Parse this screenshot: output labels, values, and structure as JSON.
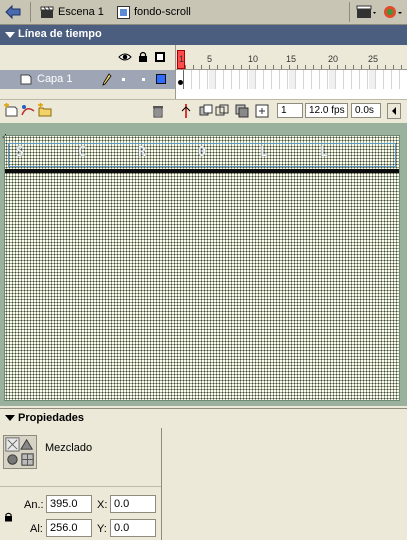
{
  "scene_bar": {
    "scene_label": "Escena 1",
    "symbol_label": "fondo-scroll"
  },
  "timeline": {
    "title": "Línea de tiempo",
    "ruler_numbers": [
      "1",
      "5",
      "10",
      "15",
      "20",
      "25"
    ],
    "layer": {
      "name": "Capa 1",
      "color": "#2f6bff"
    },
    "current_frame": "1",
    "fps": "12.0 fps",
    "elapsed": "0.0s"
  },
  "stage": {
    "scroll_letters": [
      "S",
      "C",
      "R",
      "O",
      "L",
      "L"
    ],
    "background_color": "#99b19d"
  },
  "properties": {
    "title": "Propiedades",
    "blend_label": "Mezclado",
    "width_label": "An.:",
    "width_value": "395.0",
    "height_label": "Al:",
    "height_value": "256.0",
    "x_label": "X:",
    "x_value": "0.0",
    "y_label": "Y:",
    "y_value": "0.0"
  }
}
